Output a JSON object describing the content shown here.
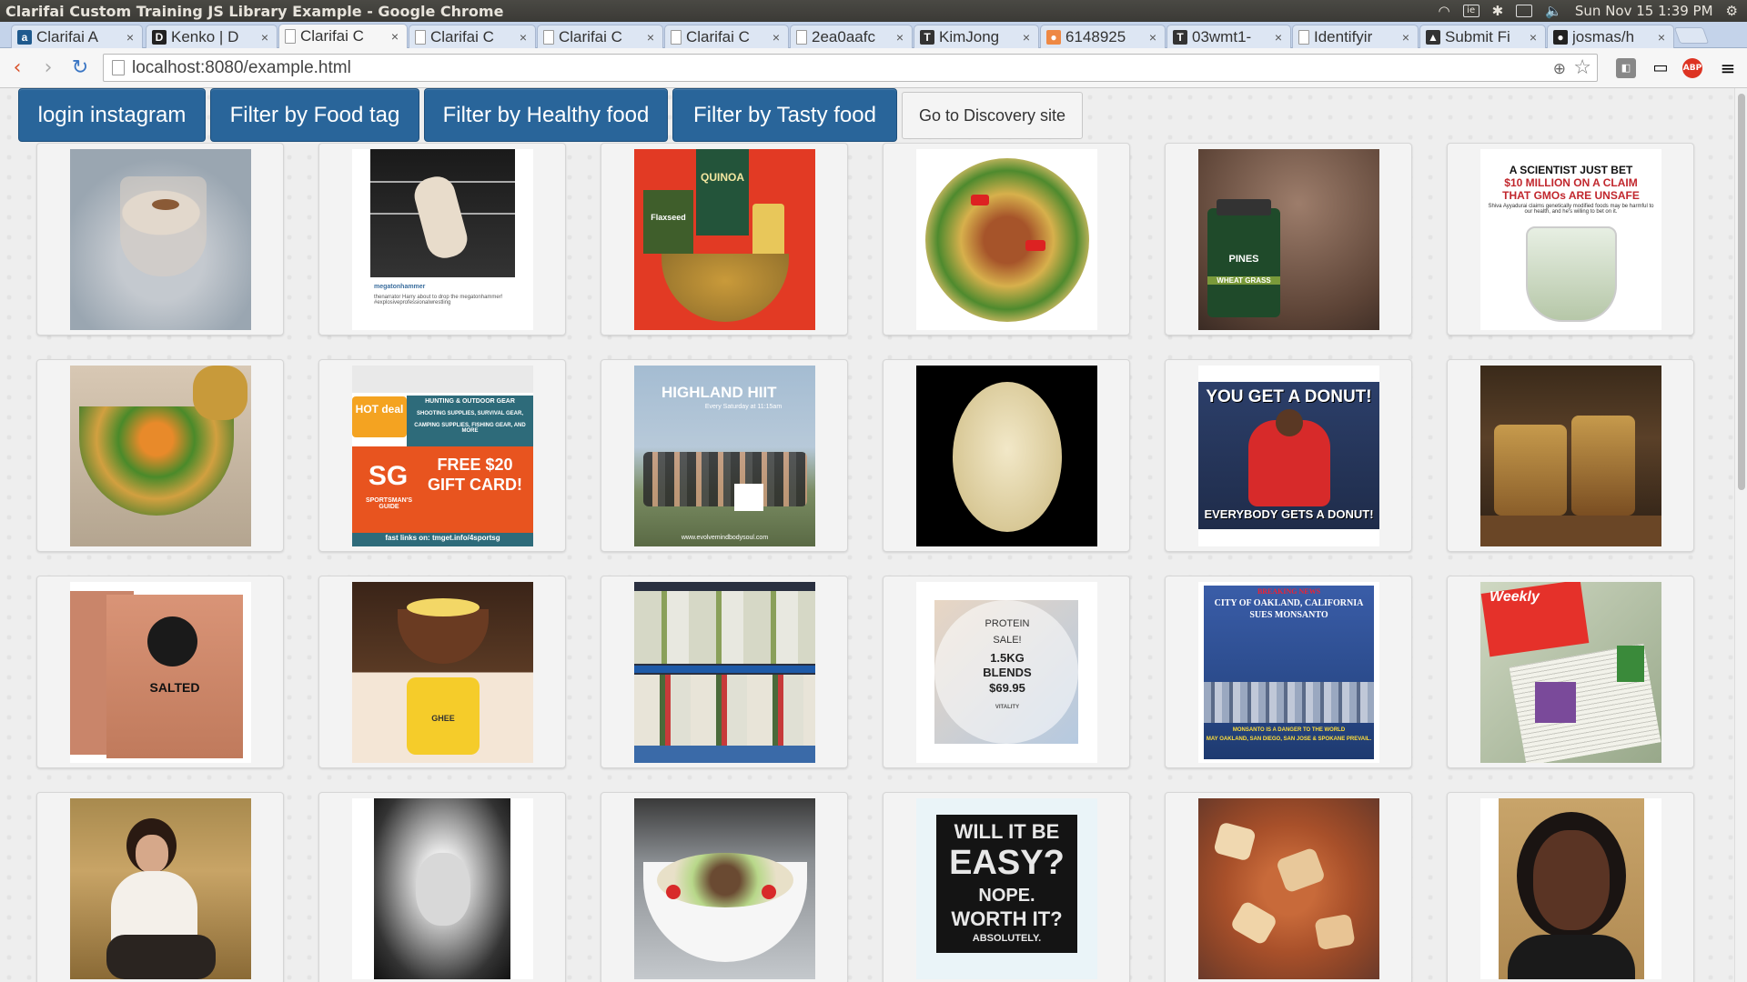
{
  "window": {
    "title": "Clarifai Custom Training JS Library Example - Google Chrome",
    "clock": "Sun Nov 15  1:39 PM"
  },
  "tabs": [
    {
      "label": "Clarifai A",
      "fav": "a",
      "color": "#1f5a8e"
    },
    {
      "label": "Kenko | D",
      "fav": "D",
      "color": "#222"
    },
    {
      "label": "Clarifai C",
      "fav": "",
      "color": "#fff",
      "active": true
    },
    {
      "label": "Clarifai C",
      "fav": "",
      "color": "#fff"
    },
    {
      "label": "Clarifai C",
      "fav": "",
      "color": "#fff"
    },
    {
      "label": "Clarifai C",
      "fav": "",
      "color": "#fff"
    },
    {
      "label": "2ea0aafc",
      "fav": "",
      "color": "#fff"
    },
    {
      "label": "KimJong",
      "fav": "T",
      "color": "#333"
    },
    {
      "label": "6148925",
      "fav": "●",
      "color": "#e84"
    },
    {
      "label": "03wmt1-",
      "fav": "T",
      "color": "#333"
    },
    {
      "label": "Identifyir",
      "fav": "",
      "color": "#fff"
    },
    {
      "label": "Submit Fi",
      "fav": "▲",
      "color": "#333"
    },
    {
      "label": "josmas/h",
      "fav": "●",
      "color": "#222"
    }
  ],
  "toolbar": {
    "url": "localhost:8080/example.html",
    "ext_badge": "ABP"
  },
  "buttons": {
    "login": "login instagram",
    "food": "Filter by Food tag",
    "healthy": "Filter by Healthy food",
    "tasty": "Filter by Tasty food",
    "discovery": "Go to Discovery site"
  },
  "captions": {
    "quinoa": "QUINOA",
    "flaxseed": "Flaxseed",
    "gmo_1": "A SCIENTIST JUST BET",
    "gmo_2": "$10 MILLION ON A CLAIM",
    "gmo_3": "THAT GMOs ARE UNSAFE",
    "gmo_4": "Shiva Ayyadurai claims genetically modified foods may be harmful to our health, and he's willing to bet on it.",
    "pines": "PINES",
    "wheatgrass": "WHEAT GRASS",
    "gear_1": "HUNTING & OUTDOOR GEAR",
    "gear_2": "SHOOTING SUPPLIES, SURVIVAL GEAR,",
    "gear_3": "CAMPING SUPPLIES, FISHING GEAR, AND MORE",
    "gear_hot": "HOT deal",
    "gear_offer": "FREE $20 GIFT CARD!",
    "gear_brand": "SG",
    "gear_brand_sub": "SPORTSMAN'S GUIDE",
    "gear_link": "fast links on: tmget.info/4sportsg",
    "hiit_1": "HIGHLAND",
    "hiit_2": "HIIT",
    "hiit_3": "Every Saturday at 11:15am",
    "hiit_4": "www.evolvemindbodysoul.com",
    "donut_1": "YOU GET A DONUT!",
    "donut_2": "EVERYBODY GETS A DONUT!",
    "salted": "SALTED",
    "ghee": "GHEE",
    "protein_1": "PROTEIN",
    "protein_2": "SALE!",
    "protein_3": "1.5KG",
    "protein_4": "BLENDS",
    "protein_5": "$69.95",
    "protein_6": "VITALITY",
    "news_1": "BREAKING NEWS",
    "news_2": "CITY OF OAKLAND, CALIFORNIA",
    "news_3": "SUES MONSANTO",
    "news_4": "MONSANTO IS A DANGER TO THE WORLD",
    "news_5": "MAY OAKLAND, SAN DIEGO, SAN JOSE & SPOKANE PREVAIL.",
    "weekly": "Weekly",
    "easy_1": "WILL IT BE",
    "easy_2": "EASY?",
    "easy_3": "NOPE.",
    "easy_4": "WORTH IT?",
    "easy_5": "ABSOLUTELY.",
    "insta_1": "megatonhammer",
    "insta_2": "thenarrator Harry about to drop the megatonhammer! #explosiveprofessionalwrestling"
  }
}
